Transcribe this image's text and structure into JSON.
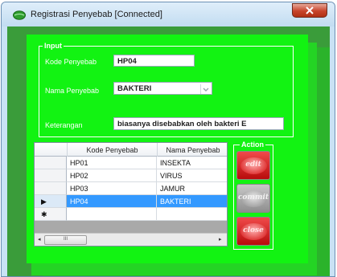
{
  "window": {
    "title": "Registrasi Penyebab [Connected]"
  },
  "colors": {
    "panel": "#12f312",
    "client_bg": "#3a9c3a",
    "selection": "#3399ff",
    "action_red": "#d01e1e"
  },
  "input_group": {
    "legend": "Input",
    "kode_label": "Kode Penyebab",
    "kode_value": "HP04",
    "nama_label": "Nama Penyebab",
    "nama_value": "BAKTERI",
    "keterangan_label": "Keterangan",
    "keterangan_value": "biasanya disebabkan oleh bakteri E"
  },
  "grid": {
    "columns": [
      "Kode Penyebab",
      "Nama Penyebab"
    ],
    "rows": [
      {
        "kode": "HP01",
        "nama": "INSEKTA",
        "marker": ""
      },
      {
        "kode": "HP02",
        "nama": "VIRUS",
        "marker": ""
      },
      {
        "kode": "HP03",
        "nama": "JAMUR",
        "marker": ""
      },
      {
        "kode": "HP04",
        "nama": "BAKTERI",
        "marker": "▶"
      }
    ],
    "new_row_marker": "✱",
    "selected_row": 3,
    "scroll_left": "◂",
    "scroll_right": "▸",
    "scroll_thumb": "III"
  },
  "action_group": {
    "legend": "Action",
    "buttons": [
      {
        "label": "edit",
        "enabled": true
      },
      {
        "label": "commit",
        "enabled": false
      },
      {
        "label": "close",
        "enabled": true
      }
    ]
  },
  "icons": {
    "app": "green-leaf-icon",
    "close": "close-icon"
  }
}
